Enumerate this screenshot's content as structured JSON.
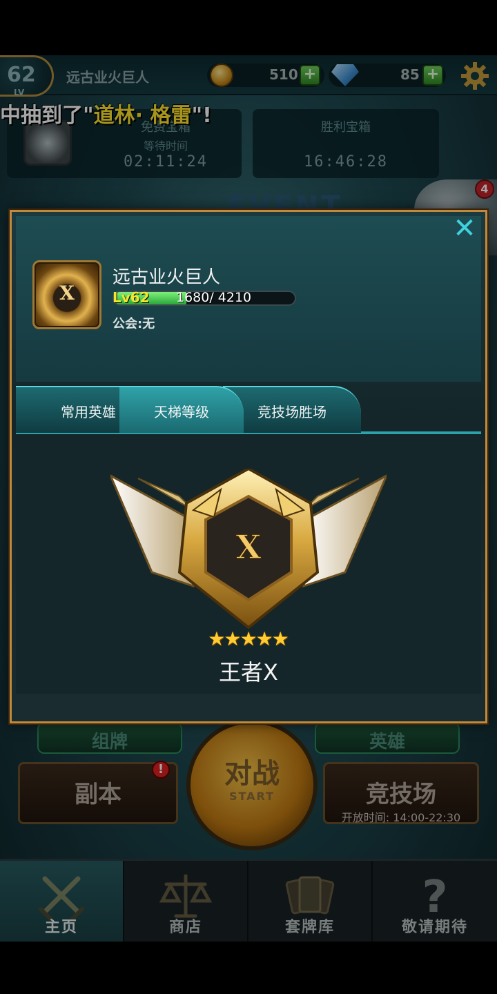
{
  "player": {
    "level": "62",
    "level_label": "LV",
    "name": "远古业火巨人"
  },
  "resources": {
    "gold": "510",
    "gems": "85",
    "plus_label": "+"
  },
  "ticker": {
    "prefix": "中抽到了\"",
    "highlight": "道林· 格雷",
    "suffix": "\"!"
  },
  "chests": {
    "free": {
      "title": "免费宝箱",
      "subtitle": "等待时间",
      "time": "02:11:24"
    },
    "victory": {
      "title": "胜利宝箱",
      "time": "16:46:28"
    }
  },
  "event_banner": "EVENT",
  "notification_count": "4",
  "profile_popup": {
    "close_symbol": "✕",
    "avatar_letter": "X",
    "name": "远古业火巨人",
    "level_text": "Lv62",
    "xp_current": 1680,
    "xp_max": 4210,
    "xp_text": "1680/ 4210",
    "guild_text": "公会:无",
    "tabs": [
      {
        "label": "常用英雄"
      },
      {
        "label": "天梯等级"
      },
      {
        "label": "竞技场胜场"
      }
    ],
    "active_tab": 1,
    "rank": {
      "emblem_letter": "X",
      "stars": 5,
      "name": "王者Ⅹ"
    }
  },
  "main_menu": {
    "deck_label": "组牌",
    "hero_label": "英雄",
    "dungeon_label": "副本",
    "alert_symbol": "!",
    "battle_label": "对战",
    "battle_sub": "START",
    "arena_label": "竞技场",
    "arena_hours": "开放时间: 14:00-22:30"
  },
  "bottom_nav": [
    {
      "label": "主页",
      "icon": "crossed-swords-icon"
    },
    {
      "label": "商店",
      "icon": "scales-icon"
    },
    {
      "label": "套牌库",
      "icon": "cards-icon"
    },
    {
      "label": "敬请期待",
      "icon": "question-icon"
    }
  ],
  "colors": {
    "accent_teal": "#3fd2df",
    "gold_border": "#c08a3a",
    "xp_green": "#2aa83a",
    "level_yellow": "#f3e530",
    "ticker_highlight": "#ffe430"
  }
}
